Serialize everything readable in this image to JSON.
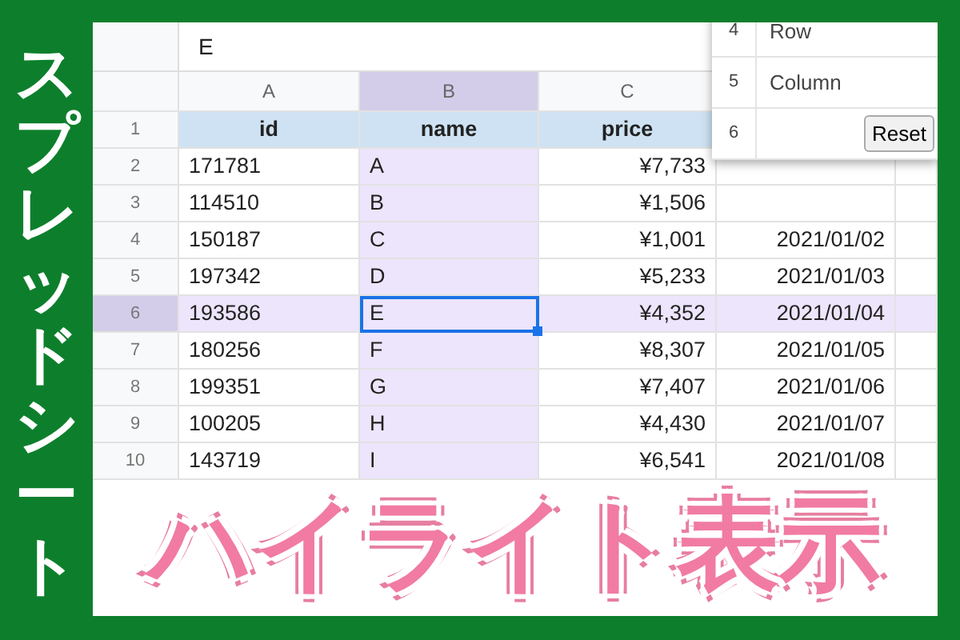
{
  "side_title": "スプレッドシート",
  "formula_bar": {
    "value": "E"
  },
  "columns": [
    {
      "label": "A",
      "selected": false
    },
    {
      "label": "B",
      "selected": true
    },
    {
      "label": "C",
      "selected": false
    }
  ],
  "rows": [
    {
      "number": "1",
      "kind": "header",
      "selected": false,
      "cells": [
        "id",
        "name",
        "price"
      ]
    },
    {
      "number": "2",
      "kind": "data",
      "selected": false,
      "cells": [
        "171781",
        "A",
        "¥7,733"
      ]
    },
    {
      "number": "3",
      "kind": "data",
      "selected": false,
      "cells": [
        "114510",
        "B",
        "¥1,506"
      ]
    },
    {
      "number": "4",
      "kind": "data",
      "selected": false,
      "cells": [
        "150187",
        "C",
        "¥1,001",
        "2021/01/02"
      ]
    },
    {
      "number": "5",
      "kind": "data",
      "selected": false,
      "cells": [
        "197342",
        "D",
        "¥5,233",
        "2021/01/03"
      ]
    },
    {
      "number": "6",
      "kind": "data",
      "selected": true,
      "cells": [
        "193586",
        "E",
        "¥4,352",
        "2021/01/04"
      ]
    },
    {
      "number": "7",
      "kind": "data",
      "selected": false,
      "cells": [
        "180256",
        "F",
        "¥8,307",
        "2021/01/05"
      ]
    },
    {
      "number": "8",
      "kind": "data",
      "selected": false,
      "cells": [
        "199351",
        "G",
        "¥7,407",
        "2021/01/06"
      ]
    },
    {
      "number": "9",
      "kind": "data",
      "selected": false,
      "cells": [
        "100205",
        "H",
        "¥4,430",
        "2021/01/07"
      ]
    },
    {
      "number": "10",
      "kind": "data",
      "selected": false,
      "cells": [
        "143719",
        "I",
        "¥6,541",
        "2021/01/08"
      ]
    }
  ],
  "panel": {
    "rows": [
      {
        "number": "4",
        "kind": "label",
        "text": "Row"
      },
      {
        "number": "5",
        "kind": "label",
        "text": "Column"
      },
      {
        "number": "6",
        "kind": "button",
        "text": "Reset"
      }
    ]
  },
  "banner": "ハイライト表示"
}
